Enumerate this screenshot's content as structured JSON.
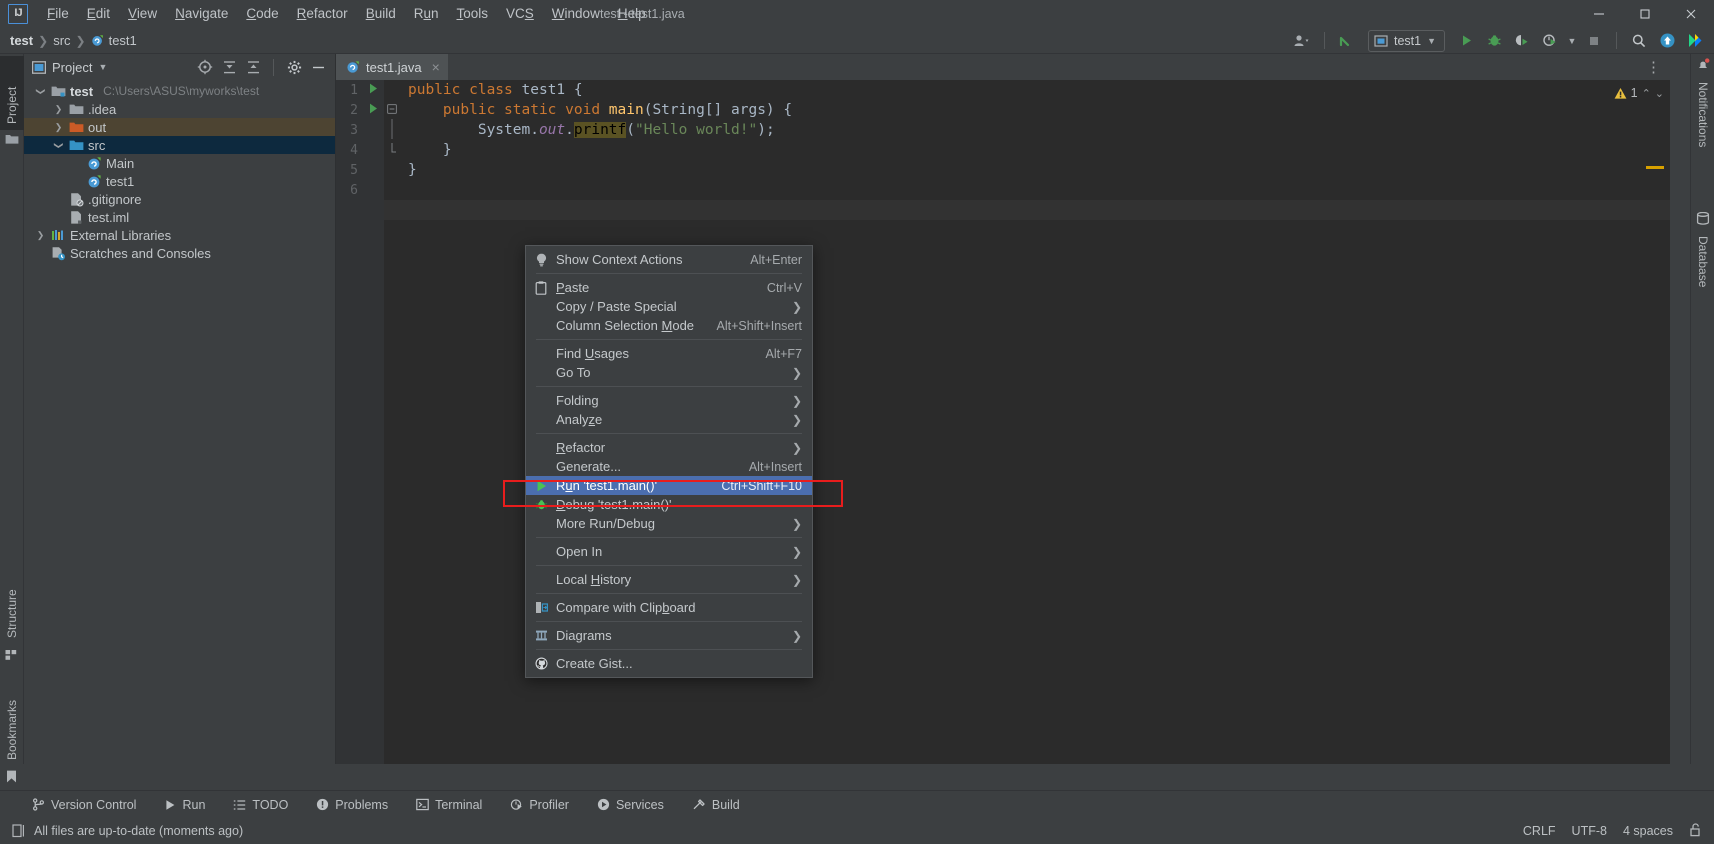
{
  "window": {
    "title": "test - test1.java",
    "logo_text": "IJ",
    "controls": [
      "minimize",
      "maximize",
      "close"
    ]
  },
  "menubar": {
    "items": [
      {
        "label": "File",
        "mnemonic": "F"
      },
      {
        "label": "Edit",
        "mnemonic": "E"
      },
      {
        "label": "View",
        "mnemonic": "V"
      },
      {
        "label": "Navigate",
        "mnemonic": "N"
      },
      {
        "label": "Code",
        "mnemonic": "C"
      },
      {
        "label": "Refactor",
        "mnemonic": "R"
      },
      {
        "label": "Build",
        "mnemonic": "B"
      },
      {
        "label": "Run",
        "mnemonic": "u"
      },
      {
        "label": "Tools",
        "mnemonic": "T"
      },
      {
        "label": "VCS",
        "mnemonic": "S"
      },
      {
        "label": "Window",
        "mnemonic": "W"
      },
      {
        "label": "Help",
        "mnemonic": "H"
      }
    ]
  },
  "navbar": {
    "breadcrumbs": [
      "test",
      "src",
      "test1"
    ],
    "run_config": "test1",
    "icons": [
      "user-icon",
      "update-project-icon",
      "run-icon",
      "debug-icon",
      "run-coverage-icon",
      "profiler-icon",
      "stop-icon",
      "search-icon",
      "upload-icon",
      "ide-icon"
    ]
  },
  "left_strip": {
    "tabs": [
      "Project",
      "Structure",
      "Bookmarks"
    ]
  },
  "right_strip": {
    "tabs": [
      "Notifications",
      "Database"
    ]
  },
  "project_panel": {
    "title": "Project",
    "tree": [
      {
        "label": "test",
        "path": "C:\\Users\\ASUS\\myworks\\test",
        "icon": "module-icon",
        "chevron": "down",
        "depth": 0,
        "bold": true,
        "state": "normal"
      },
      {
        "label": ".idea",
        "path": "",
        "icon": "folder-icon",
        "chevron": "right",
        "depth": 1,
        "bold": false,
        "state": "normal"
      },
      {
        "label": "out",
        "path": "",
        "icon": "folder-orange-icon",
        "chevron": "right",
        "depth": 1,
        "bold": false,
        "state": "excluded"
      },
      {
        "label": "src",
        "path": "",
        "icon": "folder-source-icon",
        "chevron": "down",
        "depth": 1,
        "bold": false,
        "state": "selected"
      },
      {
        "label": "Main",
        "path": "",
        "icon": "java-class-icon",
        "chevron": "none",
        "depth": 2,
        "bold": false,
        "state": "normal"
      },
      {
        "label": "test1",
        "path": "",
        "icon": "java-class-icon",
        "chevron": "none",
        "depth": 2,
        "bold": false,
        "state": "normal"
      },
      {
        "label": ".gitignore",
        "path": "",
        "icon": "gitignore-file-icon",
        "chevron": "none",
        "depth": 1,
        "bold": false,
        "state": "normal"
      },
      {
        "label": "test.iml",
        "path": "",
        "icon": "iml-file-icon",
        "chevron": "none",
        "depth": 1,
        "bold": false,
        "state": "normal"
      },
      {
        "label": "External Libraries",
        "path": "",
        "icon": "libraries-icon",
        "chevron": "right",
        "depth": 0,
        "bold": false,
        "state": "normal"
      },
      {
        "label": "Scratches and Consoles",
        "path": "",
        "icon": "scratches-icon",
        "chevron": "none",
        "depth": 0,
        "bold": false,
        "state": "normal"
      }
    ]
  },
  "editor": {
    "tab": {
      "label": "test1.java",
      "icon": "java-class-icon",
      "close": "×"
    },
    "lines": [
      {
        "num": "1",
        "runnable": true,
        "fold": "",
        "tokens": [
          {
            "t": "public ",
            "c": "kw"
          },
          {
            "t": "class ",
            "c": "kw"
          },
          {
            "t": "test1 {",
            "c": "cls"
          }
        ]
      },
      {
        "num": "2",
        "runnable": true,
        "fold": "minus",
        "tokens": [
          {
            "t": "    public ",
            "c": "kw"
          },
          {
            "t": "static ",
            "c": "kw"
          },
          {
            "t": "void ",
            "c": "kw"
          },
          {
            "t": "main",
            "c": "mth"
          },
          {
            "t": "(String[] args) {",
            "c": "cls"
          }
        ]
      },
      {
        "num": "3",
        "runnable": false,
        "fold": "bar",
        "tokens": [
          {
            "t": "        System.",
            "c": "cls"
          },
          {
            "t": "out",
            "c": "fld"
          },
          {
            "t": ".",
            "c": "cls"
          },
          {
            "t": "printf",
            "c": "hl"
          },
          {
            "t": "(",
            "c": "cls"
          },
          {
            "t": "\"Hello world!\"",
            "c": "str"
          },
          {
            "t": ");",
            "c": "cls"
          }
        ]
      },
      {
        "num": "4",
        "runnable": false,
        "fold": "end",
        "tokens": [
          {
            "t": "    }",
            "c": "cls"
          }
        ]
      },
      {
        "num": "5",
        "runnable": false,
        "fold": "",
        "tokens": [
          {
            "t": "}",
            "c": "cls"
          }
        ]
      },
      {
        "num": "6",
        "runnable": false,
        "fold": "",
        "tokens": [
          {
            "t": "",
            "c": "cls"
          }
        ]
      }
    ],
    "warning_count": "1"
  },
  "context_menu": {
    "items": [
      {
        "label": "Show Context Actions",
        "mnemonic": "",
        "accel": "Alt+Enter",
        "icon": "lightbulb-icon",
        "arrow": false,
        "selected": false
      },
      {
        "sep": true
      },
      {
        "label": "Paste",
        "mnemonic": "P",
        "accel": "Ctrl+V",
        "icon": "clipboard-icon",
        "arrow": false,
        "selected": false
      },
      {
        "label": "Copy / Paste Special",
        "mnemonic": "",
        "accel": "",
        "icon": "",
        "arrow": true,
        "selected": false
      },
      {
        "label": "Column Selection Mode",
        "mnemonic": "M",
        "accel": "Alt+Shift+Insert",
        "icon": "",
        "arrow": false,
        "selected": false
      },
      {
        "sep": true
      },
      {
        "label": "Find Usages",
        "mnemonic": "U",
        "accel": "Alt+F7",
        "icon": "",
        "arrow": false,
        "selected": false
      },
      {
        "label": "Go To",
        "mnemonic": "",
        "accel": "",
        "icon": "",
        "arrow": true,
        "selected": false
      },
      {
        "sep": true
      },
      {
        "label": "Folding",
        "mnemonic": "",
        "accel": "",
        "icon": "",
        "arrow": true,
        "selected": false
      },
      {
        "label": "Analyze",
        "mnemonic": "z",
        "accel": "",
        "icon": "",
        "arrow": true,
        "selected": false
      },
      {
        "sep": true
      },
      {
        "label": "Refactor",
        "mnemonic": "R",
        "accel": "",
        "icon": "",
        "arrow": true,
        "selected": false
      },
      {
        "label": "Generate...",
        "mnemonic": "",
        "accel": "Alt+Insert",
        "icon": "",
        "arrow": false,
        "selected": false
      },
      {
        "label": "Run 'test1.main()'",
        "mnemonic": "u",
        "accel": "Ctrl+Shift+F10",
        "icon": "run-green-icon",
        "arrow": false,
        "selected": true
      },
      {
        "label": "Debug 'test1.main()'",
        "mnemonic": "D",
        "accel": "",
        "icon": "debug-green-icon",
        "arrow": false,
        "selected": false
      },
      {
        "label": "More Run/Debug",
        "mnemonic": "",
        "accel": "",
        "icon": "",
        "arrow": true,
        "selected": false
      },
      {
        "sep": true
      },
      {
        "label": "Open In",
        "mnemonic": "",
        "accel": "",
        "icon": "",
        "arrow": true,
        "selected": false
      },
      {
        "sep": true
      },
      {
        "label": "Local History",
        "mnemonic": "H",
        "accel": "",
        "icon": "",
        "arrow": true,
        "selected": false
      },
      {
        "sep": true
      },
      {
        "label": "Compare with Clipboard",
        "mnemonic": "b",
        "accel": "",
        "icon": "compare-icon",
        "arrow": false,
        "selected": false
      },
      {
        "sep": true
      },
      {
        "label": "Diagrams",
        "mnemonic": "",
        "accel": "",
        "icon": "diagram-icon",
        "arrow": true,
        "selected": false
      },
      {
        "sep": true
      },
      {
        "label": "Create Gist...",
        "mnemonic": "",
        "accel": "",
        "icon": "github-icon",
        "arrow": false,
        "selected": false
      }
    ],
    "highlight_color": "#e81d1d",
    "selection_color": "#4b6eaf"
  },
  "bottom_bar": {
    "items": [
      {
        "label": "Version Control",
        "icon": "branch-icon"
      },
      {
        "label": "Run",
        "icon": "run-icon"
      },
      {
        "label": "TODO",
        "icon": "todo-icon"
      },
      {
        "label": "Problems",
        "icon": "problems-icon"
      },
      {
        "label": "Terminal",
        "icon": "terminal-icon"
      },
      {
        "label": "Profiler",
        "icon": "profiler-icon"
      },
      {
        "label": "Services",
        "icon": "services-icon"
      },
      {
        "label": "Build",
        "icon": "build-icon"
      }
    ]
  },
  "status_bar": {
    "message": "All files are up-to-date (moments ago)",
    "line_separator": "CRLF",
    "encoding": "UTF-8",
    "indent": "4 spaces",
    "lock_icon": "unlocked-icon"
  }
}
